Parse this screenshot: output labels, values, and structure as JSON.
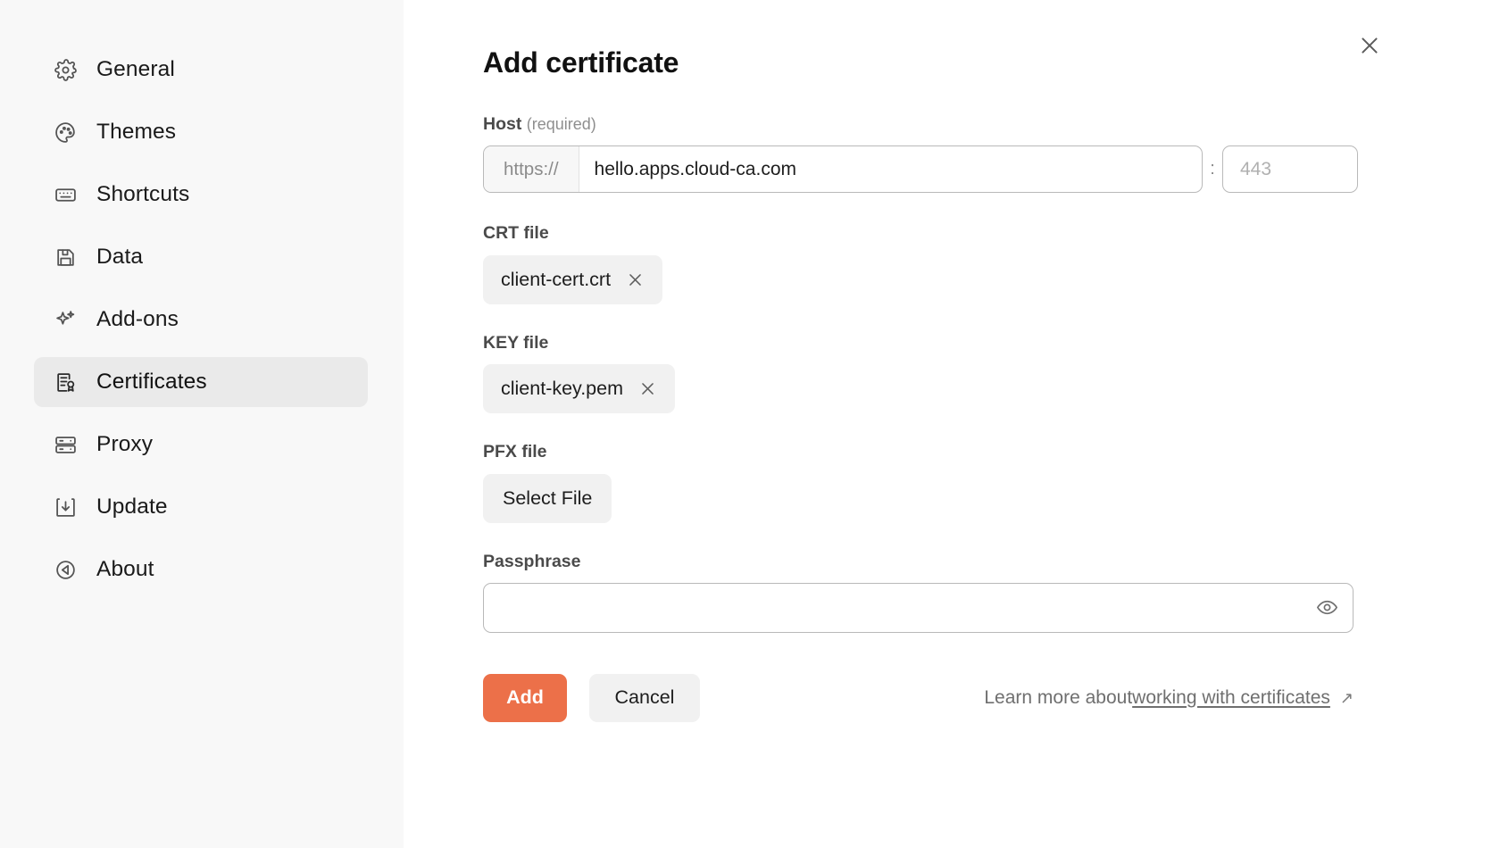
{
  "sidebar": {
    "items": [
      {
        "label": "General",
        "icon": "gear-icon",
        "active": false
      },
      {
        "label": "Themes",
        "icon": "palette-icon",
        "active": false
      },
      {
        "label": "Shortcuts",
        "icon": "keyboard-icon",
        "active": false
      },
      {
        "label": "Data",
        "icon": "floppy-disk-icon",
        "active": false
      },
      {
        "label": "Add-ons",
        "icon": "sparkles-icon",
        "active": false
      },
      {
        "label": "Certificates",
        "icon": "certificate-icon",
        "active": true
      },
      {
        "label": "Proxy",
        "icon": "server-icon",
        "active": false
      },
      {
        "label": "Update",
        "icon": "download-icon",
        "active": false
      },
      {
        "label": "About",
        "icon": "info-circle-icon",
        "active": false
      }
    ]
  },
  "dialog": {
    "title": "Add certificate",
    "close_icon": "close-icon"
  },
  "host": {
    "label": "Host",
    "required_note": "(required)",
    "scheme": "https://",
    "value": "hello.apps.cloud-ca.com",
    "placeholder": "",
    "separator": ":",
    "port_value": "",
    "port_placeholder": "443"
  },
  "crt": {
    "label": "CRT file",
    "file_name": "client-cert.crt",
    "remove_icon": "close-icon"
  },
  "key": {
    "label": "KEY file",
    "file_name": "client-key.pem",
    "remove_icon": "close-icon"
  },
  "pfx": {
    "label": "PFX file",
    "select_label": "Select File"
  },
  "passphrase": {
    "label": "Passphrase",
    "value": "",
    "placeholder": "",
    "toggle_icon": "eye-icon"
  },
  "actions": {
    "add_label": "Add",
    "cancel_label": "Cancel",
    "learn_more_prefix": "Learn more about ",
    "learn_more_link": "working with certificates",
    "external_arrow": "↗"
  },
  "colors": {
    "accent": "#EC7049",
    "sidebar_bg": "#F8F8F8",
    "active_item_bg": "#EAEAEA",
    "chip_bg": "#F1F1F1",
    "border": "#B9B9B9",
    "muted_text": "#6F6F6F"
  }
}
